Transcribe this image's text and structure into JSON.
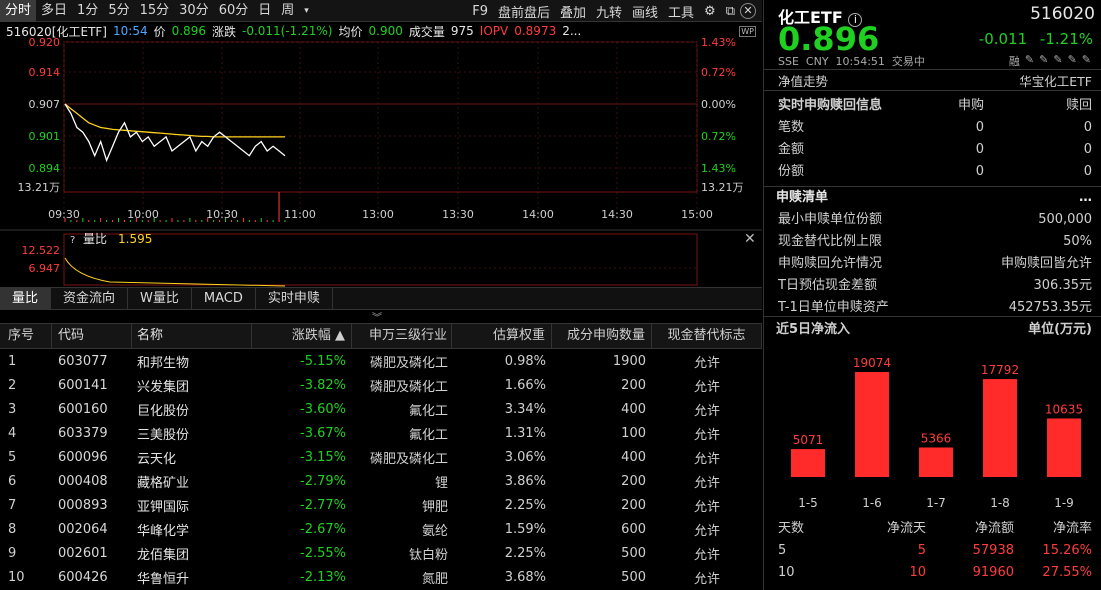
{
  "toolbar": {
    "tabs": [
      "分时",
      "多日",
      "1分",
      "5分",
      "15分",
      "30分",
      "60分",
      "日",
      "周",
      "▾"
    ],
    "right": [
      "F9",
      "盘前盘后",
      "叠加",
      "九转",
      "画线",
      "工具"
    ]
  },
  "infobar": {
    "code_name": "516020[化工ETF]",
    "time": "10:54",
    "price_label": "价",
    "price": "0.896",
    "change_label": "涨跌",
    "change": "-0.011(-1.21%)",
    "avg_label": "均价",
    "avg": "0.900",
    "vol_label": "成交量",
    "vol": "975",
    "iopv_label": "IOPV",
    "iopv": "0.8973",
    "more": "2..."
  },
  "chart": {
    "y_left": [
      "0.920",
      "0.914",
      "0.907",
      "0.901",
      "0.894"
    ],
    "y_right": [
      "1.43%",
      "0.72%",
      "0.00%",
      "0.72%",
      "1.43%"
    ],
    "vol_label": "13.21万",
    "x_labels": [
      "09:30",
      "10:00",
      "10:30",
      "11:00",
      "13:00",
      "13:30",
      "14:00",
      "14:30",
      "15:00"
    ],
    "sub_y": [
      "12.522",
      "6.947"
    ],
    "sub_label": "量比",
    "sub_value": "1.595",
    "help": "?",
    "price_series": [
      0.907,
      0.905,
      0.902,
      0.901,
      0.899,
      0.896,
      0.899,
      0.895,
      0.898,
      0.901,
      0.903,
      0.9,
      0.901,
      0.899,
      0.9,
      0.898,
      0.899,
      0.9,
      0.897,
      0.898,
      0.899,
      0.9,
      0.897,
      0.899,
      0.898,
      0.9,
      0.901,
      0.9,
      0.899,
      0.898,
      0.897,
      0.896,
      0.898,
      0.899,
      0.897,
      0.898,
      0.897,
      0.896
    ],
    "avg_series": [
      0.907,
      0.906,
      0.905,
      0.904,
      0.903,
      0.9025,
      0.902,
      0.9018,
      0.9016,
      0.9015,
      0.9014,
      0.9013,
      0.9012,
      0.9011,
      0.901,
      0.9009,
      0.9008,
      0.9007,
      0.9006,
      0.9005,
      0.9004,
      0.9003,
      0.9002,
      0.9001,
      0.9001,
      0.9,
      0.9,
      0.9,
      0.9,
      0.9,
      0.9,
      0.9,
      0.9,
      0.9,
      0.9,
      0.9,
      0.9,
      0.9
    ]
  },
  "tabs2": [
    "量比",
    "资金流向",
    "W量比",
    "MACD",
    "实时申赎"
  ],
  "table": {
    "headers": [
      "序号",
      "代码",
      "名称",
      "涨跌幅 ▲",
      "申万三级行业",
      "估算权重",
      "成分申购数量",
      "现金替代标志"
    ],
    "rows": [
      [
        "1",
        "603077",
        "和邦生物",
        "-5.15%",
        "磷肥及磷化工",
        "0.98%",
        "1900",
        "允许"
      ],
      [
        "2",
        "600141",
        "兴发集团",
        "-3.82%",
        "磷肥及磷化工",
        "1.66%",
        "200",
        "允许"
      ],
      [
        "3",
        "600160",
        "巨化股份",
        "-3.60%",
        "氟化工",
        "3.34%",
        "400",
        "允许"
      ],
      [
        "4",
        "603379",
        "三美股份",
        "-3.67%",
        "氟化工",
        "1.31%",
        "100",
        "允许"
      ],
      [
        "5",
        "600096",
        "云天化",
        "-3.15%",
        "磷肥及磷化工",
        "3.06%",
        "400",
        "允许"
      ],
      [
        "6",
        "000408",
        "藏格矿业",
        "-2.79%",
        "锂",
        "3.86%",
        "200",
        "允许"
      ],
      [
        "7",
        "000893",
        "亚钾国际",
        "-2.77%",
        "钾肥",
        "2.25%",
        "200",
        "允许"
      ],
      [
        "8",
        "002064",
        "华峰化学",
        "-2.67%",
        "氨纶",
        "1.59%",
        "600",
        "允许"
      ],
      [
        "9",
        "002601",
        "龙佰集团",
        "-2.55%",
        "钛白粉",
        "2.25%",
        "500",
        "允许"
      ],
      [
        "10",
        "600426",
        "华鲁恒升",
        "-2.13%",
        "氮肥",
        "3.68%",
        "500",
        "允许"
      ]
    ]
  },
  "right": {
    "name": "化工ETF",
    "code": "516020",
    "price": "0.896",
    "change": "-0.011",
    "change_pct": "-1.21%",
    "meta": "SSE  CNY  10:54:51  交易中",
    "rong": "融",
    "nav_label": "净值走势",
    "fund_name": "华宝化工ETF",
    "realtime_title": "实时申购赎回信息",
    "col_sub": "申购",
    "col_red": "赎回",
    "realtime_rows": [
      [
        "笔数",
        "0",
        "0"
      ],
      [
        "金额",
        "0",
        "0"
      ],
      [
        "份额",
        "0",
        "0"
      ]
    ],
    "list_title": "申赎清单",
    "list_rows": [
      [
        "最小申赎单位份额",
        "500,000"
      ],
      [
        "现金替代比例上限",
        "50%"
      ],
      [
        "申购赎回允许情况",
        "申购赎回皆允许"
      ],
      [
        "T日预估现金差额",
        "306.35元"
      ],
      [
        "T-1日单位申赎资产",
        "452753.35元"
      ]
    ],
    "flow_title": "近5日净流入",
    "flow_unit": "单位(万元)",
    "flow_table_headers": [
      "天数",
      "净流天",
      "净流额",
      "净流率"
    ],
    "flow_table_rows": [
      [
        "5",
        "5",
        "57938",
        "15.26%"
      ],
      [
        "10",
        "10",
        "91960",
        "27.55%"
      ]
    ]
  },
  "chart_data": {
    "type": "bar",
    "categories": [
      "1-5",
      "1-6",
      "1-7",
      "1-8",
      "1-9"
    ],
    "values": [
      5071,
      19074,
      5366,
      17792,
      10635
    ],
    "title": "近5日净流入",
    "ylabel": "单位(万元)"
  },
  "colors": {
    "up": "#ff3c3c",
    "down": "#20d020",
    "price_line": "#ffffff",
    "avg_line": "#ffd21e",
    "bar": "#ff2a2a"
  }
}
